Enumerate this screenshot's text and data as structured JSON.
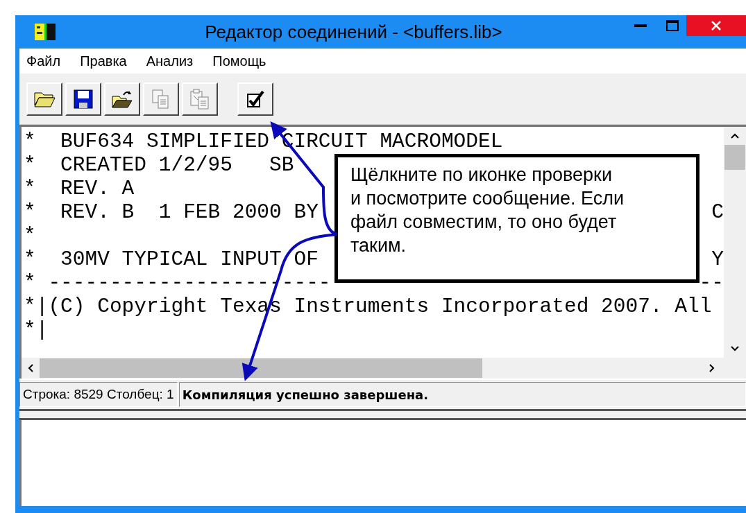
{
  "window": {
    "title": "Редактор соединений - <buffers.lib>"
  },
  "menu": [
    {
      "label": "Файл"
    },
    {
      "label": "Правка"
    },
    {
      "label": "Анализ"
    },
    {
      "label": "Помощь"
    }
  ],
  "toolbar": [
    {
      "kind": "open",
      "disabled": false
    },
    {
      "kind": "save",
      "disabled": false
    },
    {
      "kind": "reopen",
      "disabled": false
    },
    {
      "kind": "copy",
      "disabled": true
    },
    {
      "kind": "paste",
      "disabled": true
    },
    {
      "kind": "check",
      "disabled": false
    }
  ],
  "editor": {
    "lines": [
      {
        "text": "*  BUF634 SIMPLIFIED CIRCUIT MACROMODEL"
      },
      {
        "text": "*  CREATED 1/2/95   SB"
      },
      {
        "text": "*  REV. A"
      },
      {
        "text": "*  REV. B  1 FEB 2000 BY",
        "tail": "C"
      },
      {
        "text": "*"
      },
      {
        "text": "*  30MV TYPICAL INPUT OF",
        "tail": "Y"
      },
      {
        "text": "* -----------------------",
        "tail": "--"
      },
      {
        "text": "*|(C) Copyright Texas Instruments Incorporated 2007. All"
      },
      {
        "text": "*|"
      }
    ]
  },
  "callout": {
    "text": "Щёлкните по иконке проверки\nи посмотрите сообщение. Если\nфайл совместим, то оно будет\nтаким."
  },
  "status_bar": {
    "position": "Строка: 8529 Столбец: 1",
    "message": "Компиляция успешно завершена."
  }
}
